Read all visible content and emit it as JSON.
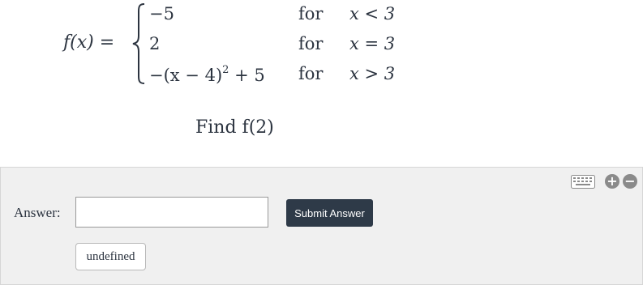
{
  "problem": {
    "function_lhs": "f(x) =",
    "cases": [
      {
        "value": "−5",
        "keyword": "for",
        "condition": "x < 3"
      },
      {
        "value": "2",
        "keyword": "for",
        "condition": "x = 3"
      },
      {
        "value_prefix": "−(x − 4)",
        "value_exponent": "2",
        "value_suffix": " + 5",
        "keyword": "for",
        "condition": "x > 3"
      }
    ],
    "prompt": "Find f(2)"
  },
  "answer_panel": {
    "label": "Answer:",
    "input_value": "",
    "submit_label": "Submit Answer",
    "undefined_label": "undefined",
    "plus_symbol": "+",
    "minus_symbol": "−",
    "icons": [
      "keyboard-icon",
      "plus-circle-icon",
      "minus-circle-icon"
    ],
    "colors": {
      "panel_bg": "#f0f0f0",
      "submit_bg": "#2e3a48"
    }
  }
}
